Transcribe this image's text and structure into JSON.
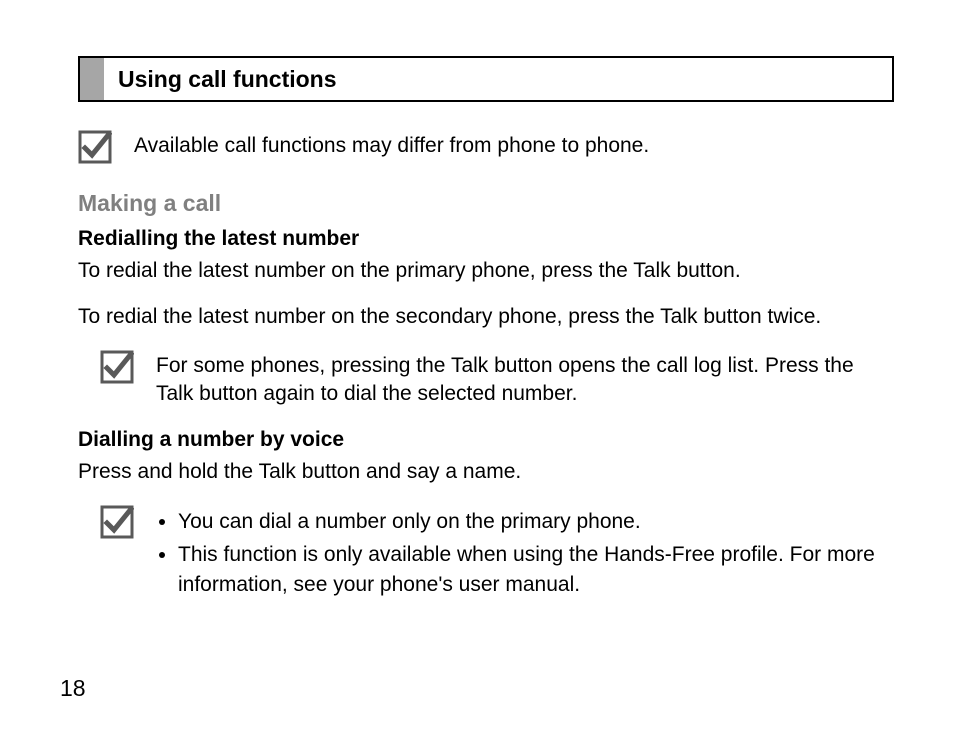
{
  "section_title": "Using call functions",
  "note_top": "Available call functions may differ from phone to phone.",
  "h2_making_call": "Making a call",
  "h3_redial": "Redialling the latest number",
  "redial_primary": "To redial the latest number on the primary phone, press the Talk button.",
  "redial_secondary": "To redial the latest number on the secondary phone, press the Talk button twice.",
  "note_call_log": "For some phones, pressing the Talk button opens the call log list. Press the Talk button again to dial the selected number.",
  "h3_voice": "Dialling a number by voice",
  "voice_instruction": "Press and hold the Talk button and say a name.",
  "voice_bullets": [
    "You can dial a number only on the primary phone.",
    "This function is only available when using the Hands-Free profile. For more information, see your phone's user manual."
  ],
  "page_number": "18"
}
